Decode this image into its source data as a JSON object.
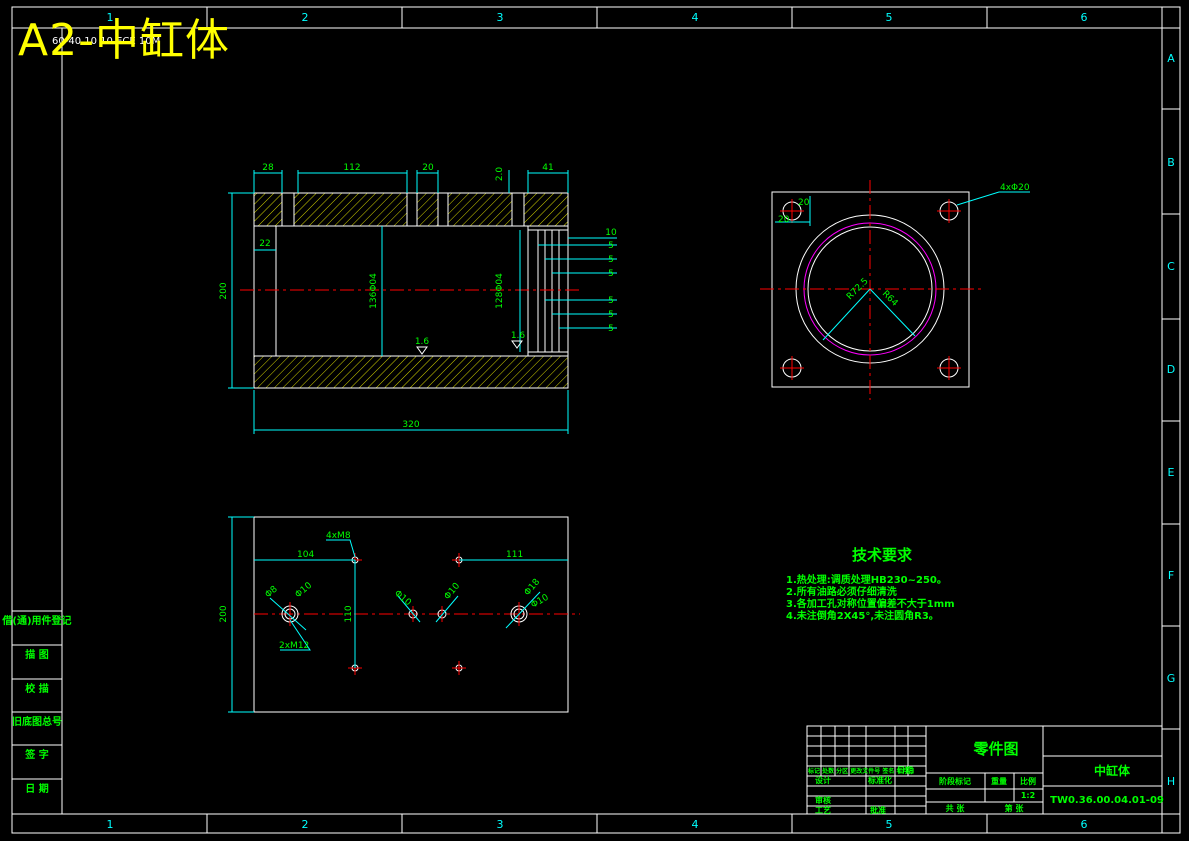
{
  "title": "A2-中缸体",
  "frame": {
    "columns": [
      "1",
      "2",
      "3",
      "4",
      "5",
      "6"
    ],
    "rows": [
      "A",
      "B",
      "C",
      "D",
      "E",
      "F",
      "G",
      "H"
    ]
  },
  "top_corner_stamp": "60-40 10 10 ECE 10M",
  "left_sidebar": [
    "借(通)用件登记",
    "描 图",
    "校 描",
    "旧底图总号",
    "签 字",
    "日 期"
  ],
  "front_view": {
    "dims_top": [
      "28",
      "112",
      "20",
      "2.0",
      "41"
    ],
    "dims_right_stack": [
      "10",
      "5",
      "5",
      "5",
      "5",
      "5",
      "5"
    ],
    "dim_overall_height": "200",
    "dim_inner_step": "22",
    "dim_bore_left": "136Φ04",
    "dim_bore_right": "128Φ04",
    "roughness_1": "1.6",
    "roughness_2": "1.6",
    "dim_overall_length": "320"
  },
  "side_view": {
    "hole_callout": "4xΦ20",
    "dim_hole_offset_x": "20",
    "dim_hole_offset_y": "20",
    "dim_r_outer": "R72.5",
    "dim_r_inner": "R64"
  },
  "bottom_view": {
    "dim_height": "200",
    "callout_m8": "4xM8",
    "dim_104": "104",
    "dim_111": "111",
    "dim_110": "110",
    "dim_phi8": "Φ8",
    "dim_phi10_a": "Φ10",
    "dim_phi10_b": "Φ10",
    "dim_phi10_c": "Φ10",
    "dim_phi10_d": "Φ10",
    "dim_phi18": "Φ18",
    "callout_m12": "2xM12"
  },
  "tech_requirements": {
    "heading": "技术要求",
    "items": [
      "1.热处理:调质处理HB230~250。",
      "2.所有油路必须仔细清洗",
      "3.各加工孔对称位置偏差不大于1mm",
      "4.未注倒角2X45°,未注圆角R3。"
    ]
  },
  "title_block": {
    "doc_type": "零件图",
    "part_name": "中缸体",
    "drawing_no": "TW0.36.00.04.01-09",
    "scale": "1:2",
    "label_stage": "阶段标记",
    "label_weight": "重量",
    "label_ratio": "比例",
    "label_sheet_total": "共 张",
    "label_sheet_no": "第 张",
    "label_design": "设计",
    "label_standard": "标准化",
    "label_review": "审核",
    "label_process": "工艺",
    "label_approve": "批准",
    "label_date": "日期",
    "label_revision": "标记 处数 分区 更改文件号 签名 年月日"
  }
}
